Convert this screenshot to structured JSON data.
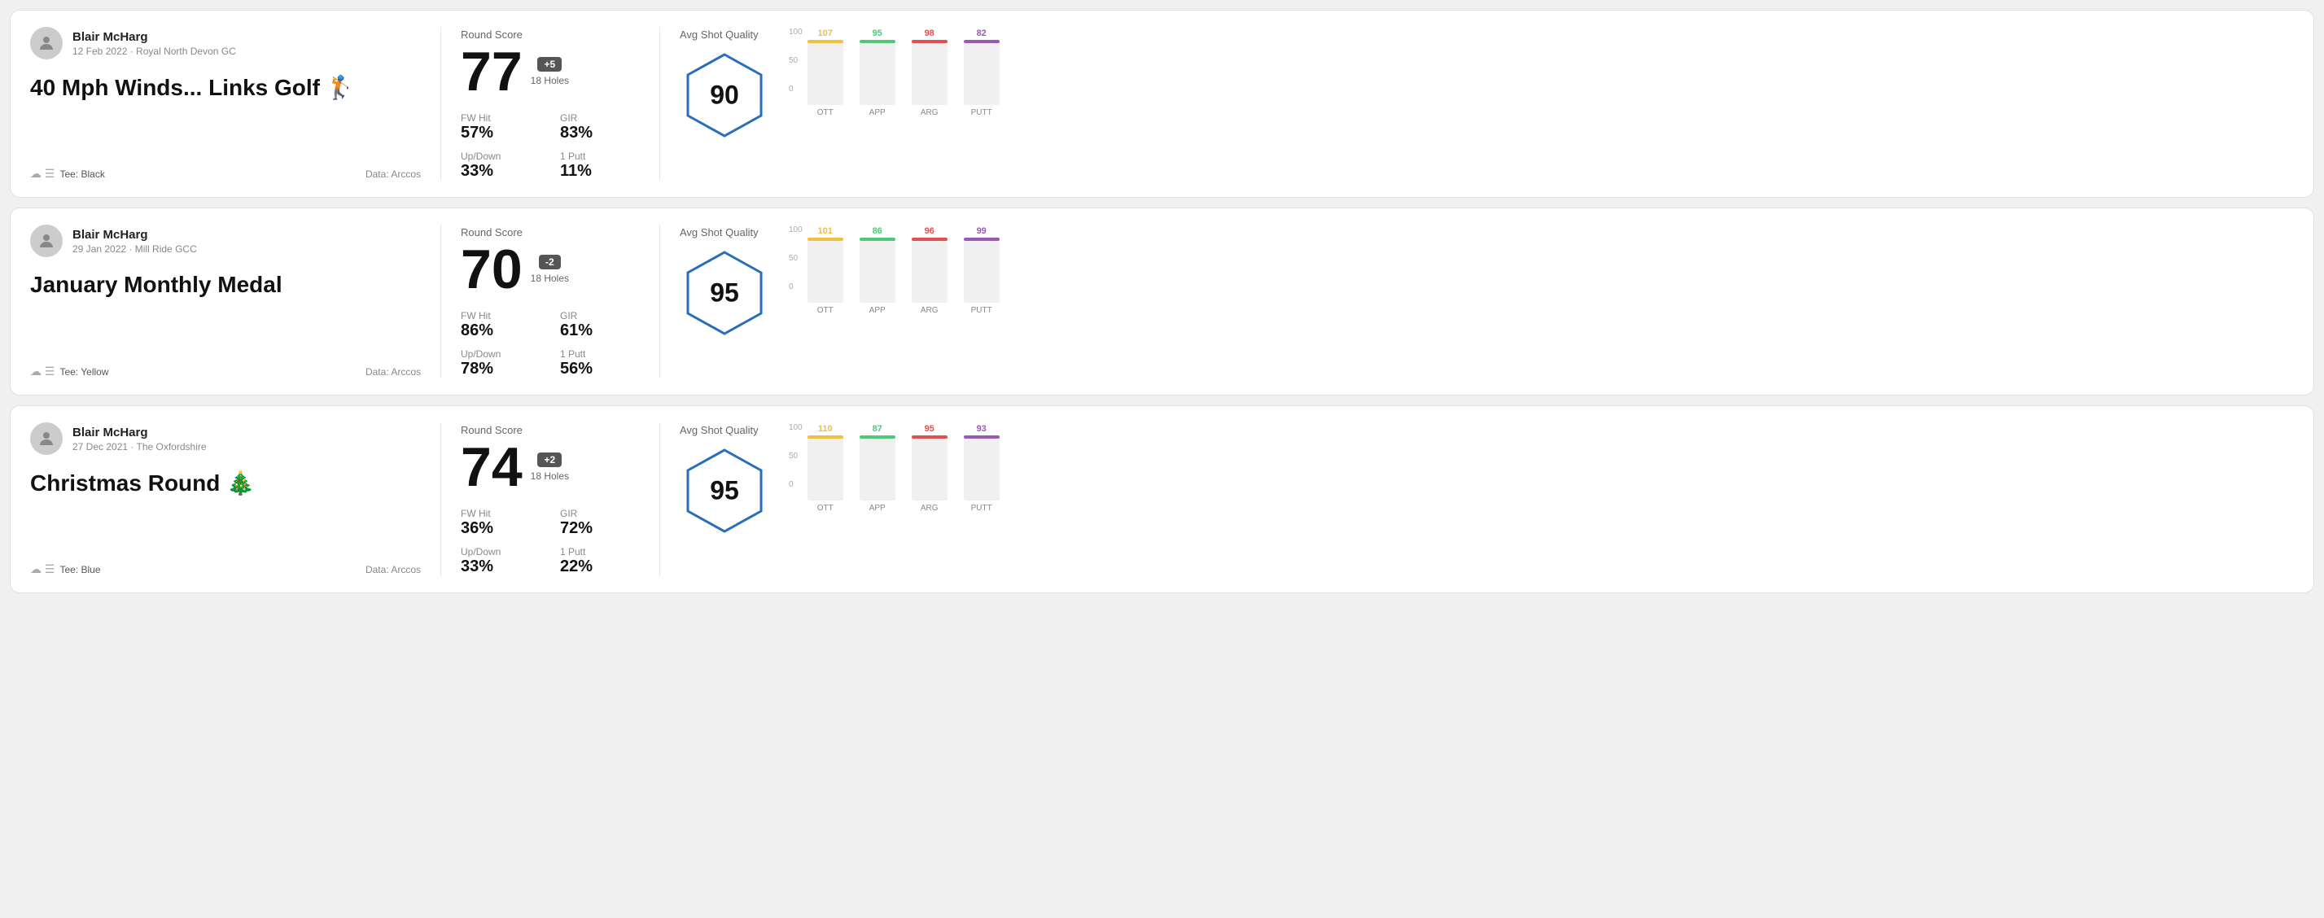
{
  "rounds": [
    {
      "id": "round1",
      "user": {
        "name": "Blair McHarg",
        "date_course": "12 Feb 2022 · Royal North Devon GC"
      },
      "title": "40 Mph Winds... Links Golf 🏌️",
      "tee": "Black",
      "data_source": "Data: Arccos",
      "round_score_label": "Round Score",
      "score": "77",
      "score_badge": "+5",
      "score_badge_type": "positive",
      "holes_label": "18 Holes",
      "fw_hit_label": "FW Hit",
      "fw_hit_value": "57%",
      "gir_label": "GIR",
      "gir_value": "83%",
      "updown_label": "Up/Down",
      "updown_value": "33%",
      "oneputt_label": "1 Putt",
      "oneputt_value": "11%",
      "avg_shot_quality_label": "Avg Shot Quality",
      "shot_quality_score": "90",
      "chart": {
        "y_ticks": [
          "100",
          "50",
          "0"
        ],
        "bars": [
          {
            "label": "OTT",
            "value": 107,
            "color": "#f0c040",
            "percent": 75
          },
          {
            "label": "APP",
            "value": 95,
            "color": "#50c878",
            "percent": 60
          },
          {
            "label": "ARG",
            "value": 98,
            "color": "#e05050",
            "percent": 65
          },
          {
            "label": "PUTT",
            "value": 82,
            "color": "#9b59b6",
            "percent": 50
          }
        ]
      }
    },
    {
      "id": "round2",
      "user": {
        "name": "Blair McHarg",
        "date_course": "29 Jan 2022 · Mill Ride GCC"
      },
      "title": "January Monthly Medal",
      "tee": "Yellow",
      "data_source": "Data: Arccos",
      "round_score_label": "Round Score",
      "score": "70",
      "score_badge": "-2",
      "score_badge_type": "negative",
      "holes_label": "18 Holes",
      "fw_hit_label": "FW Hit",
      "fw_hit_value": "86%",
      "gir_label": "GIR",
      "gir_value": "61%",
      "updown_label": "Up/Down",
      "updown_value": "78%",
      "oneputt_label": "1 Putt",
      "oneputt_value": "56%",
      "avg_shot_quality_label": "Avg Shot Quality",
      "shot_quality_score": "95",
      "chart": {
        "y_ticks": [
          "100",
          "50",
          "0"
        ],
        "bars": [
          {
            "label": "OTT",
            "value": 101,
            "color": "#f0c040",
            "percent": 72
          },
          {
            "label": "APP",
            "value": 86,
            "color": "#50c878",
            "percent": 55
          },
          {
            "label": "ARG",
            "value": 96,
            "color": "#e05050",
            "percent": 68
          },
          {
            "label": "PUTT",
            "value": 99,
            "color": "#9b59b6",
            "percent": 70
          }
        ]
      }
    },
    {
      "id": "round3",
      "user": {
        "name": "Blair McHarg",
        "date_course": "27 Dec 2021 · The Oxfordshire"
      },
      "title": "Christmas Round 🎄",
      "tee": "Blue",
      "data_source": "Data: Arccos",
      "round_score_label": "Round Score",
      "score": "74",
      "score_badge": "+2",
      "score_badge_type": "positive",
      "holes_label": "18 Holes",
      "fw_hit_label": "FW Hit",
      "fw_hit_value": "36%",
      "gir_label": "GIR",
      "gir_value": "72%",
      "updown_label": "Up/Down",
      "updown_value": "33%",
      "oneputt_label": "1 Putt",
      "oneputt_value": "22%",
      "avg_shot_quality_label": "Avg Shot Quality",
      "shot_quality_score": "95",
      "chart": {
        "y_ticks": [
          "100",
          "50",
          "0"
        ],
        "bars": [
          {
            "label": "OTT",
            "value": 110,
            "color": "#f0c040",
            "percent": 78
          },
          {
            "label": "APP",
            "value": 87,
            "color": "#50c878",
            "percent": 56
          },
          {
            "label": "ARG",
            "value": 95,
            "color": "#e05050",
            "percent": 66
          },
          {
            "label": "PUTT",
            "value": 93,
            "color": "#9b59b6",
            "percent": 63
          }
        ]
      }
    }
  ]
}
